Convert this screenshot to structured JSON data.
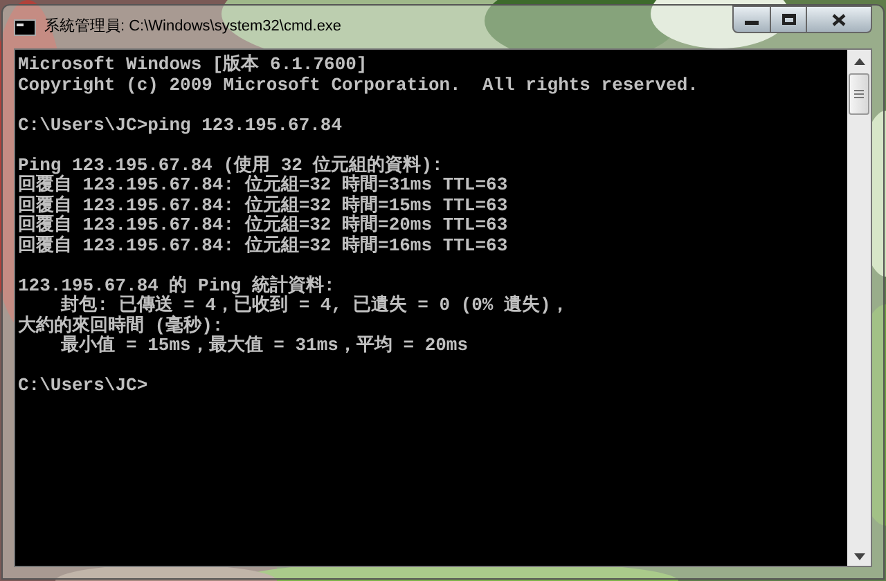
{
  "window": {
    "title": "系統管理員: C:\\Windows\\system32\\cmd.exe"
  },
  "console": {
    "blocks": [
      [
        "Microsoft Windows [版本 6.1.7600]",
        "Copyright (c) 2009 Microsoft Corporation.  All rights reserved."
      ],
      [
        "C:\\Users\\JC>ping 123.195.67.84"
      ],
      [
        "Ping 123.195.67.84 (使用 32 位元組的資料):",
        "回覆自 123.195.67.84: 位元組=32 時間=31ms TTL=63",
        "回覆自 123.195.67.84: 位元組=32 時間=15ms TTL=63",
        "回覆自 123.195.67.84: 位元組=32 時間=20ms TTL=63",
        "回覆自 123.195.67.84: 位元組=32 時間=16ms TTL=63"
      ],
      [
        "123.195.67.84 的 Ping 統計資料:",
        "    封包: 已傳送 = 4，已收到 = 4, 已遺失 = 0 (0% 遺失)，",
        "大約的來回時間 (毫秒):",
        "    最小值 = 15ms，最大值 = 31ms，平均 = 20ms"
      ],
      [
        "C:\\Users\\JC>"
      ]
    ]
  }
}
